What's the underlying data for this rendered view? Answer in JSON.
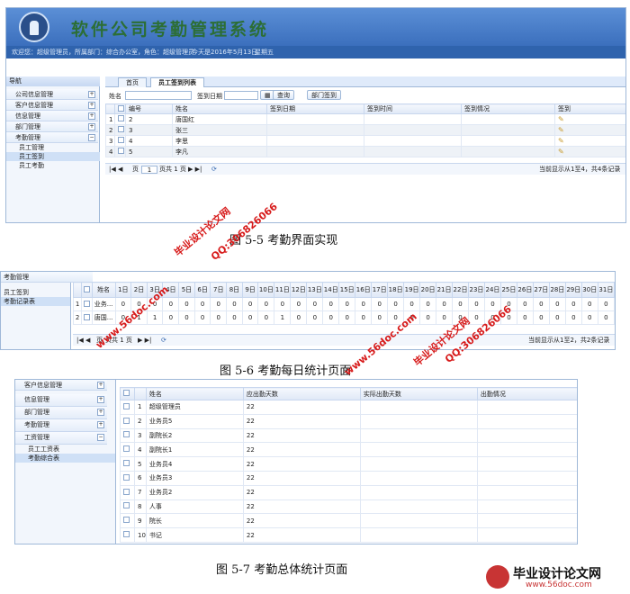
{
  "fig1": {
    "system_title": "软件公司考勤管理系统",
    "infobar": [
      "欢迎您：超级管理员，所属部门：综合办公室，角色：超级管理员",
      "今天是2016年5月13日",
      "星期五"
    ],
    "nav_title": "导航",
    "nav_items": [
      "公司信息管理",
      "客户信息管理",
      "信息管理",
      "部门管理",
      "考勤管理"
    ],
    "nav_subitems": [
      "员工管理",
      "员工签到",
      "员工考勤"
    ],
    "tabs": [
      "首页",
      "员工签到列表"
    ],
    "toolbar": {
      "name_label": "姓名",
      "date_label": "签到日期",
      "query_button": "查询",
      "dept_button": "部门签到"
    },
    "columns": [
      "编号",
      "姓名",
      "签到日期",
      "签到时间",
      "签到情况",
      "签到"
    ],
    "rows": [
      {
        "idx": "1",
        "id": "2",
        "name": "唐国红"
      },
      {
        "idx": "2",
        "id": "3",
        "name": "张三"
      },
      {
        "idx": "3",
        "id": "4",
        "name": "李思"
      },
      {
        "idx": "4",
        "id": "5",
        "name": "李凡"
      }
    ],
    "pager": {
      "page_label": "页",
      "page_value": "1",
      "total": "页共 1 页",
      "summary": "当前显示从1至4，共4条记录"
    },
    "caption": "图 5-5   考勤界面实现"
  },
  "fig2": {
    "nav_title": "考勤管理",
    "nav_items": [
      "员工签到",
      "考勤记录表"
    ],
    "name_header": "姓名",
    "days": [
      "1日",
      "2日",
      "3日",
      "4日",
      "5日",
      "6日",
      "7日",
      "8日",
      "9日",
      "10日",
      "11日",
      "12日",
      "13日",
      "14日",
      "15日",
      "16日",
      "17日",
      "18日",
      "19日",
      "20日",
      "21日",
      "22日",
      "23日",
      "24日",
      "25日",
      "26日",
      "27日",
      "28日",
      "29日",
      "30日",
      "31日"
    ],
    "rows": [
      {
        "idx": "1",
        "name": "业务...",
        "values": [
          "0",
          "0",
          "0",
          "0",
          "0",
          "0",
          "0",
          "0",
          "0",
          "0",
          "0",
          "0",
          "0",
          "0",
          "0",
          "0",
          "0",
          "0",
          "0",
          "0",
          "0",
          "0",
          "0",
          "0",
          "0",
          "0",
          "0",
          "0",
          "0",
          "0",
          "0"
        ]
      },
      {
        "idx": "2",
        "name": "唐国...",
        "values": [
          "0",
          "1",
          "1",
          "0",
          "0",
          "0",
          "0",
          "0",
          "0",
          "0",
          "1",
          "0",
          "0",
          "0",
          "0",
          "0",
          "0",
          "0",
          "0",
          "0",
          "0",
          "0",
          "0",
          "0",
          "0",
          "0",
          "0",
          "0",
          "0",
          "0",
          "0"
        ]
      }
    ],
    "pager": {
      "page_label": "页",
      "total": "页共 1 页",
      "summary": "当前显示从1至2，共2条记录"
    },
    "caption": "图 5-6 考勤每日统计页面"
  },
  "fig3": {
    "nav_items": [
      "客户信息管理",
      "信息管理",
      "部门管理",
      "考勤管理",
      "工资管理"
    ],
    "nav_subitems": [
      "员工工资表",
      "考勤综合表"
    ],
    "columns": [
      "姓名",
      "应出勤天数",
      "实际出勤天数",
      "出勤情况"
    ],
    "rows": [
      {
        "idx": "1",
        "name": "超级管理员",
        "due": "22"
      },
      {
        "idx": "2",
        "name": "业务员5",
        "due": "22"
      },
      {
        "idx": "3",
        "name": "副院长2",
        "due": "22"
      },
      {
        "idx": "4",
        "name": "副院长1",
        "due": "22"
      },
      {
        "idx": "5",
        "name": "业务员4",
        "due": "22"
      },
      {
        "idx": "6",
        "name": "业务员3",
        "due": "22"
      },
      {
        "idx": "7",
        "name": "业务员2",
        "due": "22"
      },
      {
        "idx": "8",
        "name": "人事",
        "due": "22"
      },
      {
        "idx": "9",
        "name": "院长",
        "due": "22"
      },
      {
        "idx": "10",
        "name": "书记",
        "due": "22"
      }
    ],
    "caption": "图 5-7  考勤总体统计页面"
  },
  "watermarks": {
    "site_name": "毕业设计论文网",
    "url": "www.56doc.com",
    "qq": "QQ:306826066"
  },
  "footer_logo": {
    "name": "毕业设计论文网",
    "url": "www.56doc.com"
  },
  "colors": {
    "banner": "#3b6fbd",
    "title_green": "#2c6e35",
    "watermark_red": "#d71a1a"
  }
}
